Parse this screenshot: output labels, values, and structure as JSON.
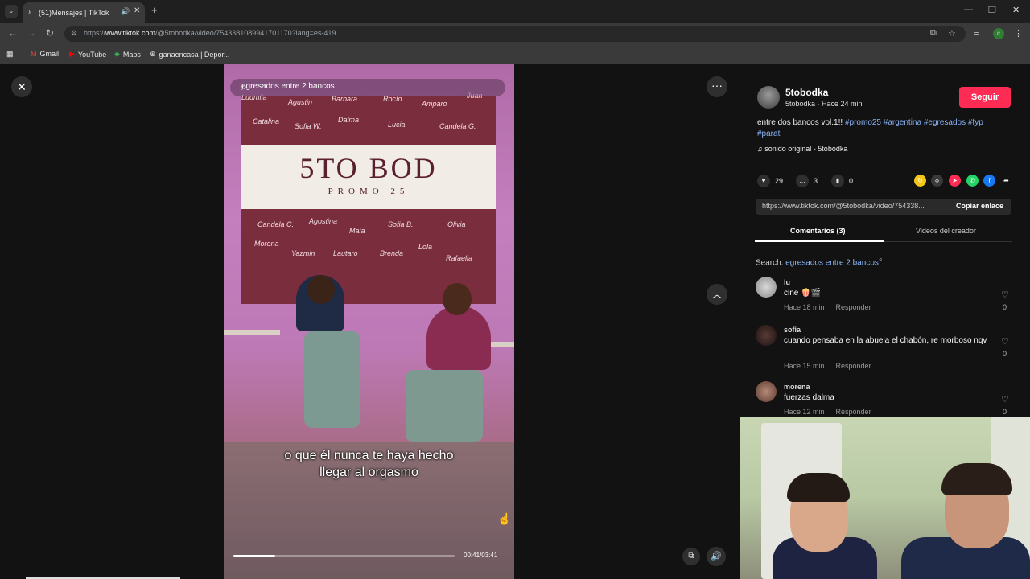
{
  "browser": {
    "tab_title": "(51)Mensajes | TikTok",
    "url_prefix": "https://",
    "url_domain": "www.tiktok.com",
    "url_path": "/@5tobodka/video/7543381089941701170?lang=es-419",
    "bookmarks": [
      "Gmail",
      "YouTube",
      "Maps",
      "ganaencasa | Depor..."
    ]
  },
  "video": {
    "search_text": "egresados entre 2 bancos",
    "banner_title": "5TO BOD",
    "banner_sub": "PROMO 25",
    "banner_names_top": [
      "Ludmila",
      "Agustin",
      "Barbara",
      "Rocío",
      "Amparo",
      "Juan",
      "Catalina",
      "Sofia W.",
      "Dalma",
      "Lucia",
      "Candela G."
    ],
    "banner_names_bottom": [
      "Candela C.",
      "Agostina",
      "Maia",
      "Sofia B.",
      "Olivia",
      "Morena",
      "Yazmin",
      "Lautaro",
      "Brenda",
      "Lola",
      "Rafaella"
    ],
    "caption_line1": "o que él nunca te haya hecho",
    "caption_line2": "llegar al orgasmo",
    "time": "00:41/03:41",
    "progress": 0.19
  },
  "sidebar": {
    "username": "5tobodka",
    "meta": "5tobodka · Hace 24 min",
    "follow_label": "Seguir",
    "desc_text": "entre dos bancos vol.1!! ",
    "desc_tags": "#promo25 #argentina #egresados #fyp #parati",
    "sound": "sonido original - 5tobodka",
    "likes": "29",
    "comments": "3",
    "saves": "0",
    "link": "https://www.tiktok.com/@5tobodka/video/754338...",
    "copy_label": "Copiar enlace",
    "tab_comments": "Comentarios (3)",
    "tab_videos": "Videos del creador",
    "search_label": "Search: ",
    "search_query": "egresados entre 2 bancos",
    "comment_list": [
      {
        "user": "lu",
        "text": "cine 🍿🎬",
        "time": "Hace 18 min",
        "reply": "Responder",
        "likes": "0"
      },
      {
        "user": "sofia",
        "text": "cuando pensaba en la abuela el chabón, re morboso nqv",
        "time": "Hace 15 min",
        "reply": "Responder",
        "likes": "0"
      },
      {
        "user": "morena",
        "text": "fuerzas dalma",
        "time": "Hace 12 min",
        "reply": "Responder",
        "likes": "0"
      }
    ]
  },
  "colors": {
    "accent": "#fe2c55",
    "link": "#8ab4f8"
  }
}
